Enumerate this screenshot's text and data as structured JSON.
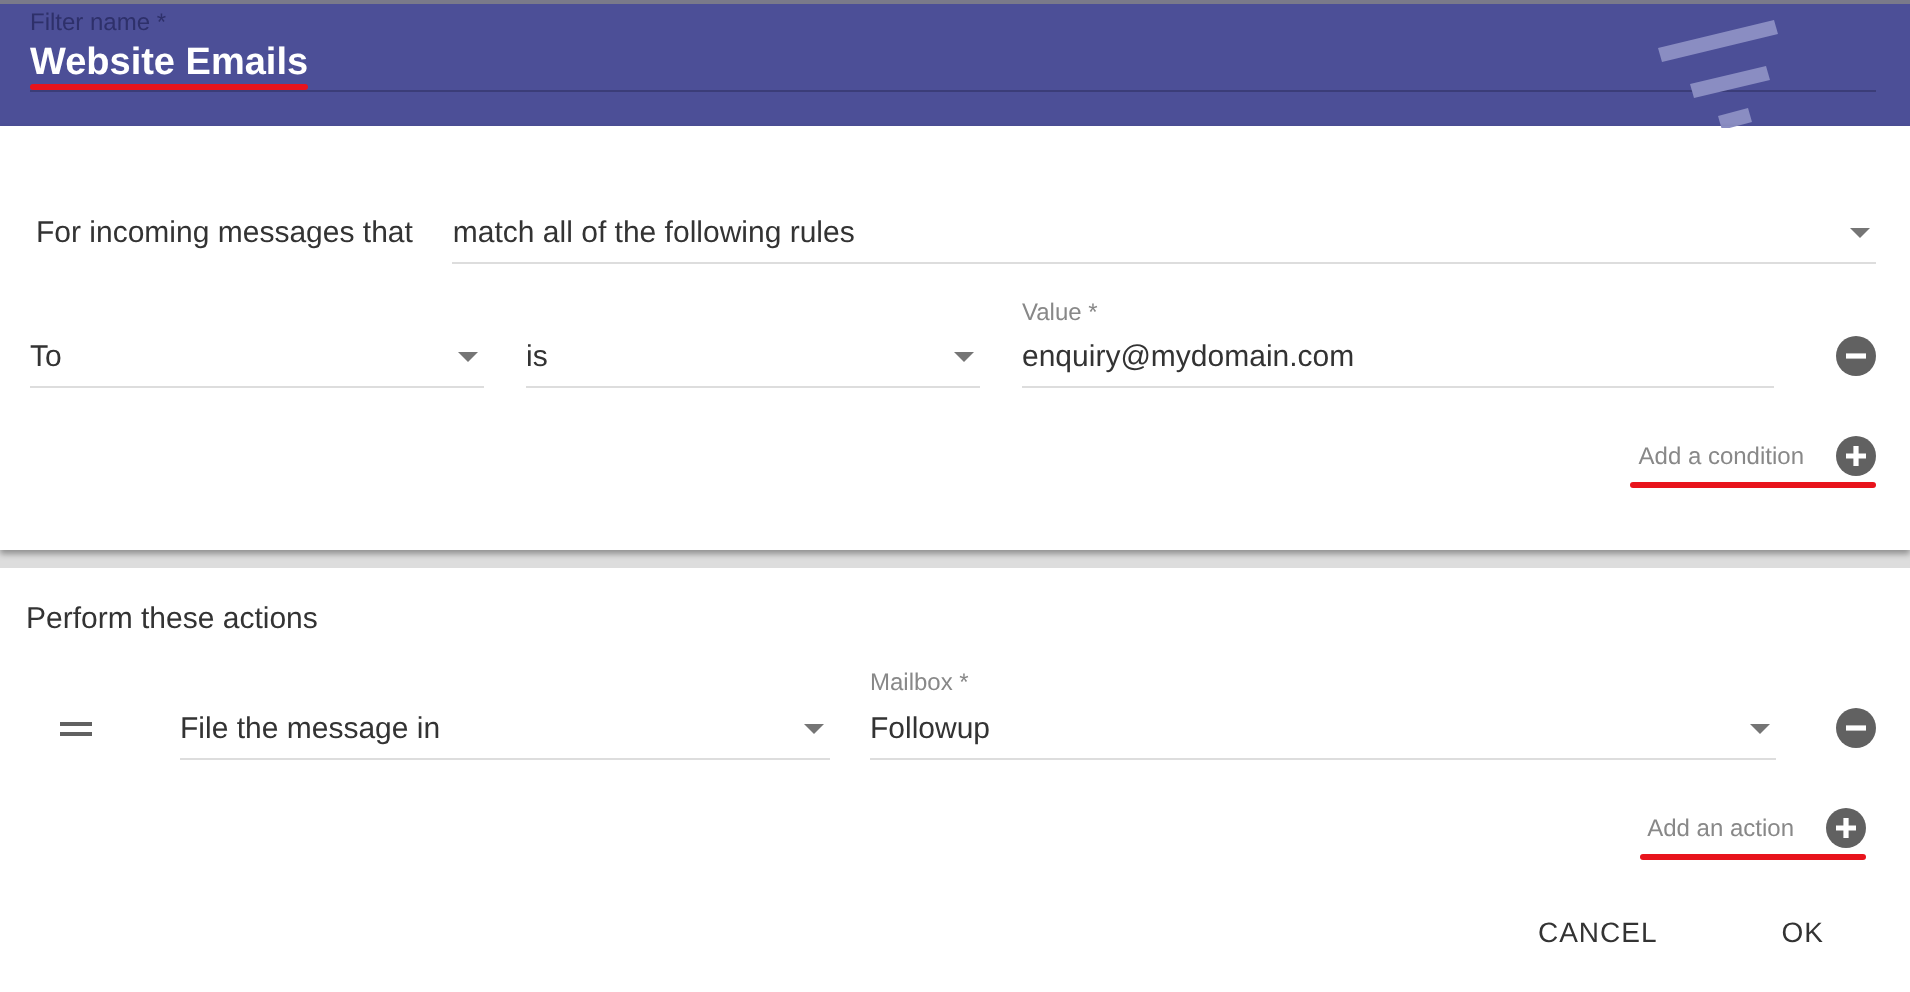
{
  "filter_name": {
    "label": "Filter name *",
    "value": "Website Emails",
    "highlighted": true
  },
  "conditions_section": {
    "intro": "For incoming messages that",
    "match": "match all of the following rules",
    "conditions": [
      {
        "field": "To",
        "operator": "is",
        "value_label": "Value *",
        "value": "enquiry@mydomain.com"
      }
    ],
    "add_link": {
      "label": "Add a condition",
      "highlighted": true
    }
  },
  "actions_section": {
    "title": "Perform these actions",
    "actions": [
      {
        "action": "File the message in",
        "target_label": "Mailbox *",
        "target": "Followup"
      }
    ],
    "add_link": {
      "label": "Add an action",
      "highlighted": true
    }
  },
  "buttons": [
    {
      "label": "CANCEL"
    },
    {
      "label": "OK"
    }
  ]
}
